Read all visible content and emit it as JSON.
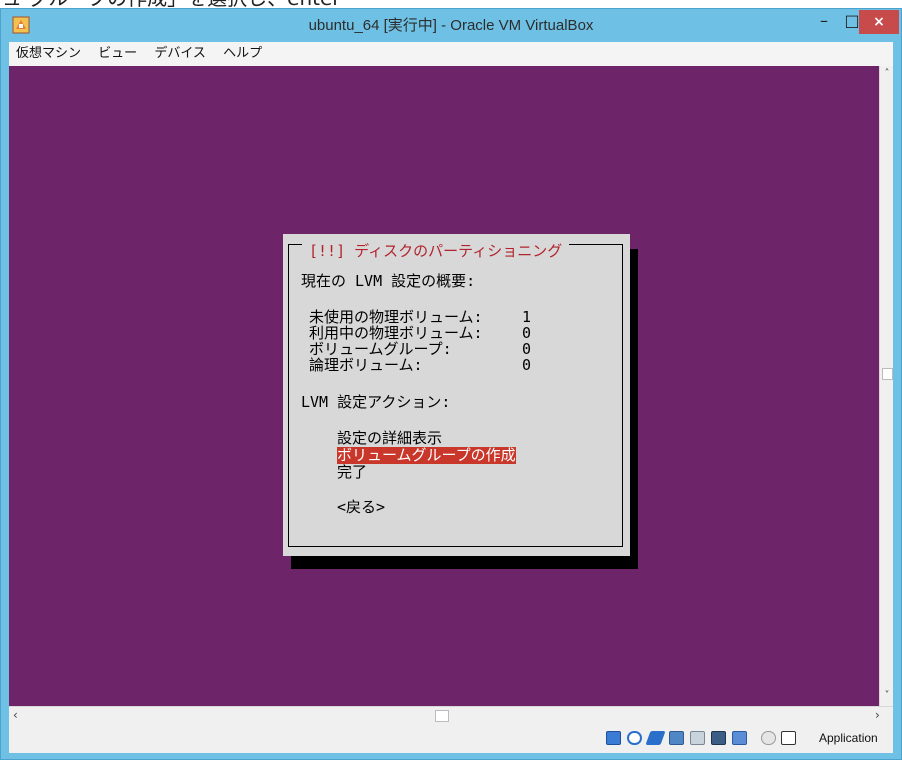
{
  "caption": "ュ グループの作成」を選択し、enter",
  "window": {
    "title": "ubuntu_64 [実行中] - Oracle VM VirtualBox",
    "min_glyph": "–",
    "max_glyph": "□",
    "close_glyph": "×"
  },
  "menu": [
    "仮想マシン",
    "ビュー",
    "デバイス",
    "ヘルプ"
  ],
  "dialog": {
    "title": "[!!] ディスクのパーティショニング",
    "summary_heading": "現在の LVM 設定の概要:",
    "summary": [
      {
        "label": "未使用の物理ボリューム:",
        "value": "1"
      },
      {
        "label": "利用中の物理ボリューム:",
        "value": "0"
      },
      {
        "label": "ボリュームグループ:",
        "value": "0"
      },
      {
        "label": "論理ボリューム:",
        "value": "0"
      }
    ],
    "actions_heading": "LVM 設定アクション:",
    "actions": [
      "設定の詳細表示",
      "ボリュームグループの作成",
      "完了"
    ],
    "selected_index": 1,
    "back_button": "<戻る>"
  },
  "statusbar": {
    "icons": [
      "hard-disk-icon",
      "optical-drive-icon",
      "usb-icon",
      "network-icon",
      "shared-folder-icon",
      "display-icon",
      "capture-icon",
      "mouse-integration-icon",
      "host-key-icon"
    ],
    "host_key_label": "Application"
  },
  "colors": {
    "screen": "#6d2468",
    "dialog": "#d8d8d8",
    "accent_red": "#c8372a",
    "title_red": "#b2232d",
    "frame": "#6ec1e4"
  }
}
